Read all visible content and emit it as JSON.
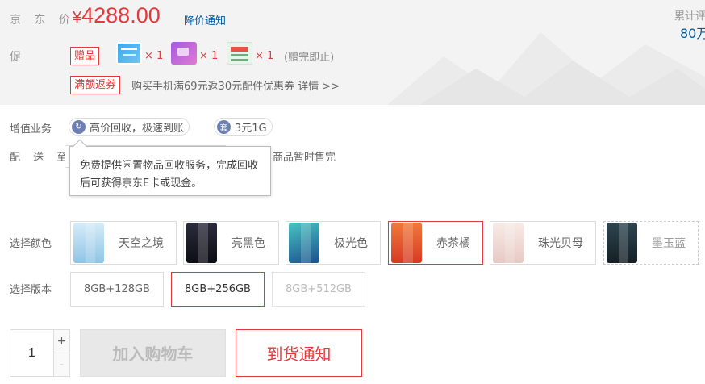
{
  "price": {
    "label": "京 东 价",
    "currency": "¥",
    "amount": "4288.00",
    "notice": "降价通知"
  },
  "sales": {
    "label": "累计评",
    "count": "80万"
  },
  "promo": {
    "label": "促  销",
    "gift_tag": "赠品",
    "gifts": [
      {
        "qty": "× 1",
        "icon": "gift-card-icon"
      },
      {
        "qty": "× 1",
        "icon": "gift-voucher-icon"
      },
      {
        "qty": "× 1",
        "icon": "gift-coupon-icon"
      }
    ],
    "gift_note": "(赠完即止)",
    "rebate_tag": "满额返券",
    "rebate_desc": "购买手机满69元返30元配件优惠券 详情 >>"
  },
  "value_added": {
    "label": "增值业务",
    "items": [
      {
        "label": "高价回收，极速到账",
        "icon": "recycle-icon",
        "glyph": "↻"
      },
      {
        "label": "3元1G",
        "icon": "data-plan-icon",
        "glyph": "套"
      }
    ],
    "tooltip": "免费提供闲置物品回收服务，完成回收后可获得京东E卡或现金。"
  },
  "delivery": {
    "label": "配 送 至",
    "status": "商品暂时售完"
  },
  "colors": {
    "label": "选择颜色",
    "options": [
      {
        "name": "天空之境",
        "swatch": "#a9d4ec"
      },
      {
        "name": "亮黑色",
        "swatch": "#1c1c2a"
      },
      {
        "name": "极光色",
        "swatch": "#1a8a9c"
      },
      {
        "name": "赤茶橘",
        "swatch": "#e2482b"
      },
      {
        "name": "珠光贝母",
        "swatch": "#efd8d3"
      },
      {
        "name": "墨玉蓝",
        "swatch": "#1d2d36"
      }
    ],
    "selected_index": 3
  },
  "versions": {
    "label": "选择版本",
    "options": [
      "8GB+128GB",
      "8GB+256GB",
      "8GB+512GB"
    ],
    "selected_index": 1
  },
  "quantity": {
    "value": "1",
    "plus": "+",
    "minus": "-"
  },
  "actions": {
    "add_to_cart": "加入购物车",
    "arrival_notice": "到货通知"
  },
  "colors_theme": {
    "accent": "#e4393c",
    "link": "#005aa0"
  }
}
